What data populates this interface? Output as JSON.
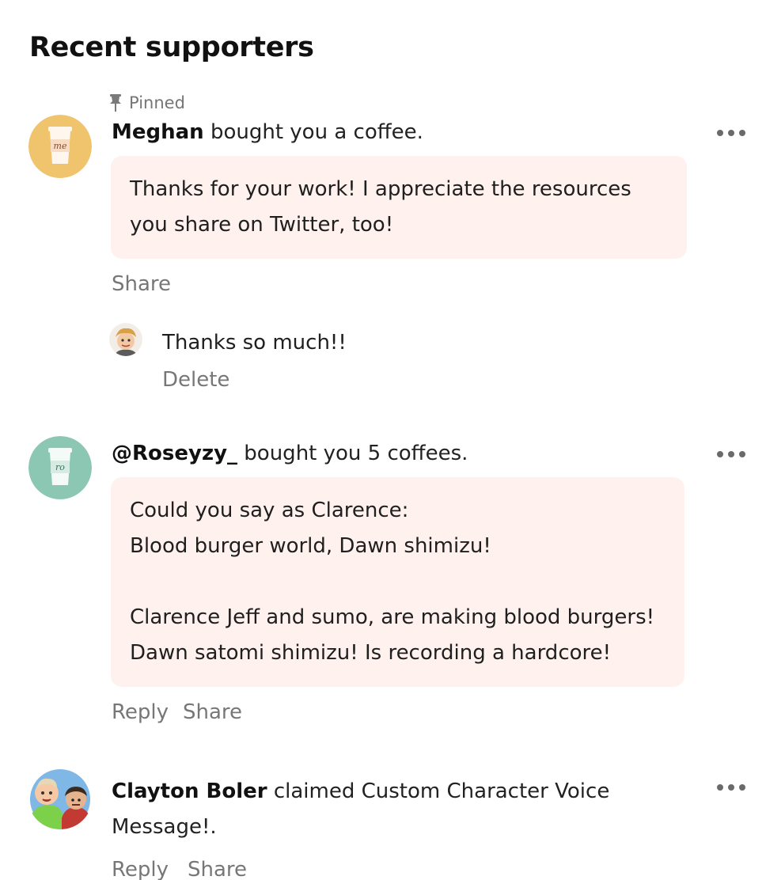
{
  "section_title": "Recent supporters",
  "icons": {
    "pin": "pin-icon",
    "more": "more-dots-icon"
  },
  "colors": {
    "bubble_bg": "#fff1ed",
    "avatar_meghan": "#f0c36d",
    "avatar_roseyzy": "#8cc7b4",
    "muted": "#777777"
  },
  "supporters": [
    {
      "pinned_label": "Pinned",
      "name": "Meghan",
      "action": " bought you a coffee.",
      "cup_label": "me",
      "message": [
        "Thanks for your work! I appreciate the resources",
        "you share on Twitter, too!"
      ],
      "actions": [
        "Share"
      ],
      "creator_reply": {
        "text": "Thanks so much!!",
        "delete_label": "Delete"
      }
    },
    {
      "name": "@Roseyzy_",
      "action": " bought you 5 coffees.",
      "cup_label": "ro",
      "message": [
        "Could you say as Clarence:",
        "Blood burger world, Dawn shimizu!",
        "",
        "Clarence Jeff and sumo, are making blood burgers!",
        "Dawn satomi shimizu! Is recording a hardcore!"
      ],
      "actions": [
        "Reply",
        "Share"
      ]
    },
    {
      "name": "Clayton Boler",
      "action": " claimed Custom Character Voice",
      "action_line2": "Message!.",
      "actions": [
        "Reply",
        "Share"
      ]
    }
  ]
}
